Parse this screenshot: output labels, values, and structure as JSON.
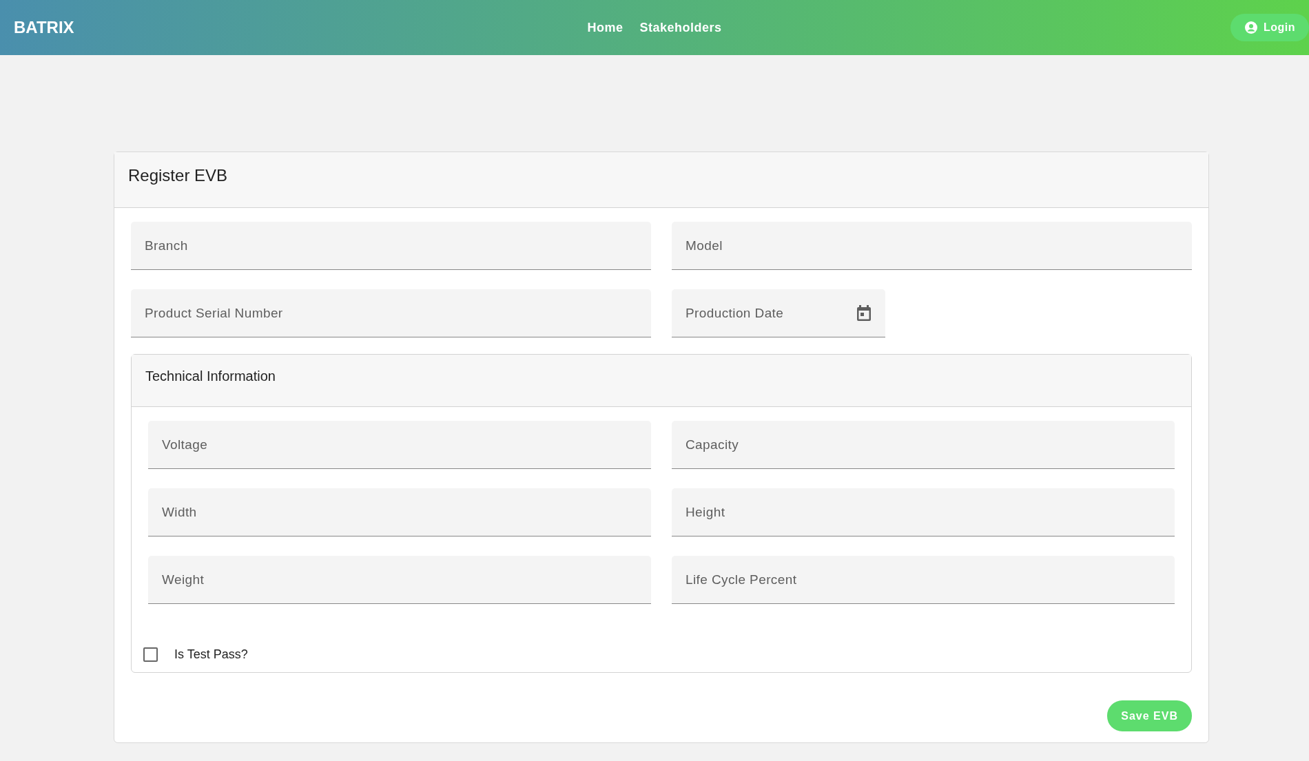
{
  "navbar": {
    "brand": "BATRIX",
    "links": [
      {
        "label": "Home"
      },
      {
        "label": "Stakeholders"
      }
    ],
    "login": "Login"
  },
  "form": {
    "title": "Register EVB",
    "fields": [
      {
        "placeholder": "Branch",
        "kind": "text"
      },
      {
        "placeholder": "Model",
        "kind": "text"
      },
      {
        "placeholder": "Product Serial Number",
        "kind": "text"
      },
      {
        "placeholder": "Production Date",
        "kind": "date"
      }
    ],
    "technical": {
      "title": "Technical Information",
      "fields": [
        {
          "placeholder": "Voltage"
        },
        {
          "placeholder": "Capacity"
        },
        {
          "placeholder": "Width"
        },
        {
          "placeholder": "Height"
        },
        {
          "placeholder": "Weight"
        },
        {
          "placeholder": "Life Cycle Percent"
        }
      ],
      "test_pass": {
        "label": "Is Test Pass?",
        "checked": false
      }
    },
    "save": "Save EVB"
  }
}
